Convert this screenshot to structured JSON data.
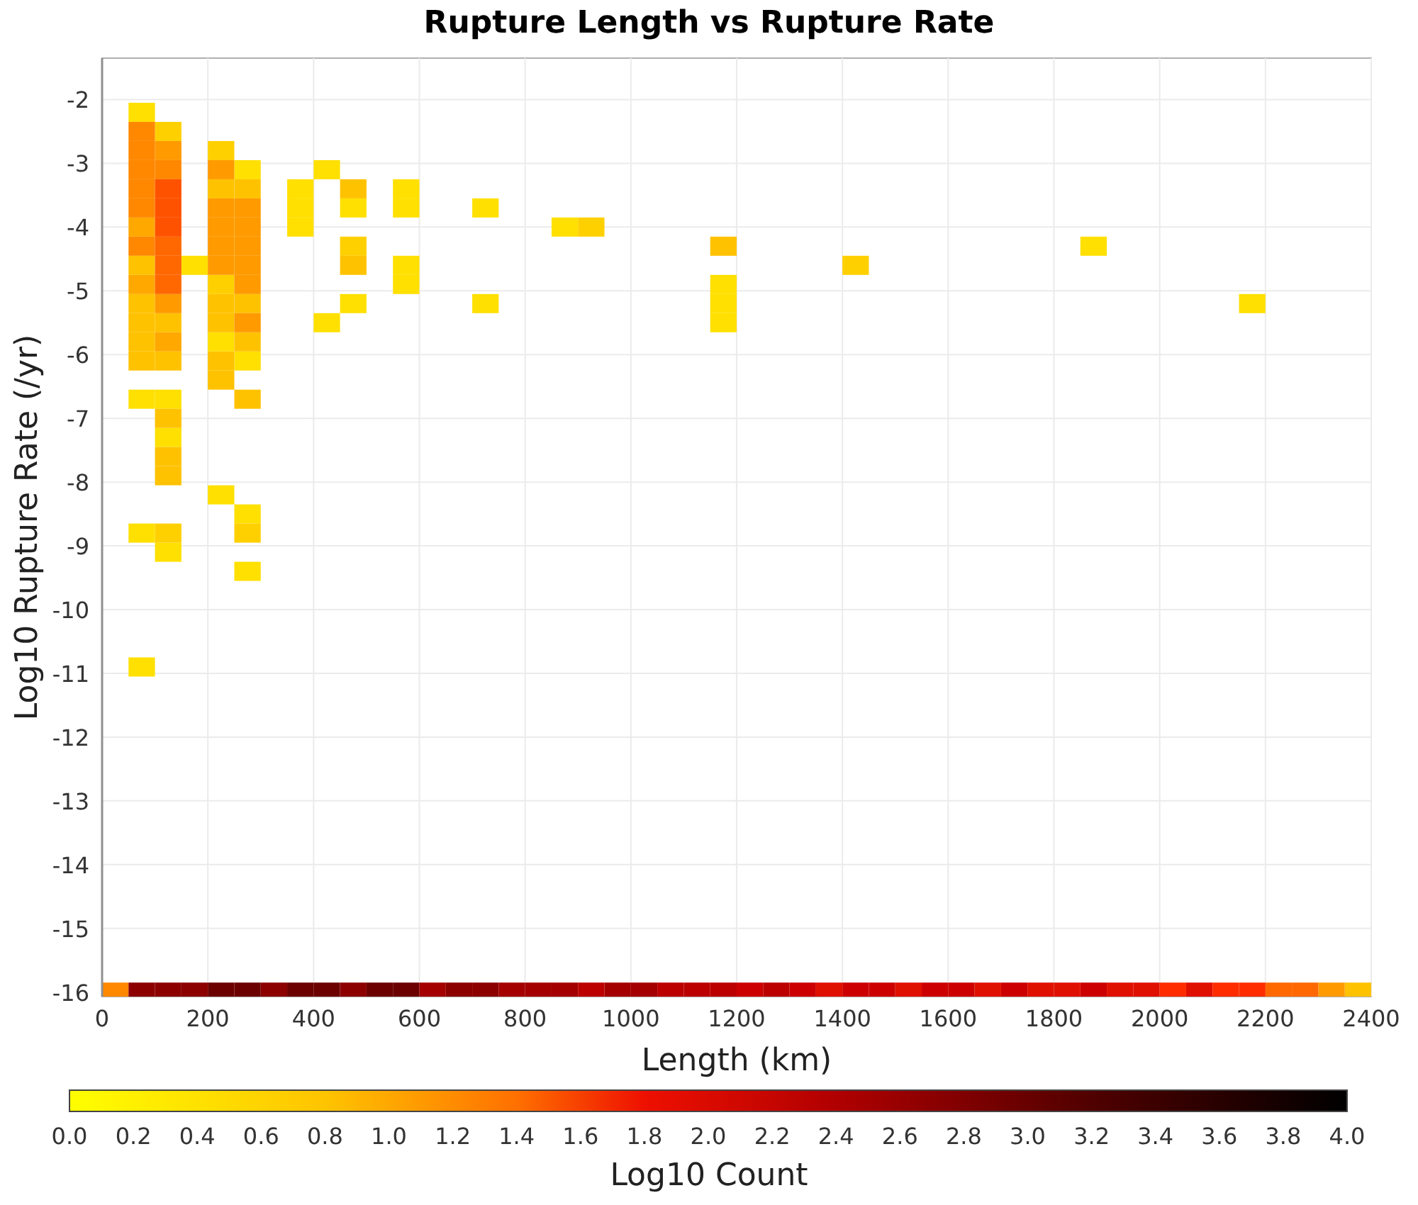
{
  "chart_data": {
    "type": "scatter",
    "title": "Rupture Length vs Rupture Rate",
    "xlabel": "Length (km)",
    "ylabel": "Log10 Rupture Rate (/yr)",
    "xlim": [
      0,
      2400
    ],
    "ylim": [
      -16.07,
      -1.35
    ],
    "xticks": [
      0,
      200,
      400,
      600,
      800,
      1000,
      1200,
      1400,
      1600,
      1800,
      2000,
      2200,
      2400
    ],
    "grid": true,
    "yticks": [
      -16,
      -15,
      -14,
      -13,
      -12,
      -11,
      -10,
      -9,
      -8,
      -7,
      -6,
      -5,
      -4,
      -3,
      -2
    ],
    "series": [
      {
        "color": "#ffe000",
        "x": [
          75,
          75,
          75,
          75,
          125,
          125,
          125,
          175,
          225,
          225,
          275,
          275,
          275,
          275,
          375,
          375,
          375,
          425,
          425,
          475,
          475,
          575,
          575,
          575,
          575,
          725,
          725,
          875,
          1175,
          1175,
          1175,
          1875,
          2175
        ],
        "values": [
          -2.2,
          -6.7,
          -8.8,
          -10.9,
          -6.7,
          -7.3,
          -9.1,
          -4.6,
          -5.8,
          -8.2,
          -3.1,
          -6.1,
          -8.5,
          -9.4,
          -3.4,
          -3.7,
          -4.0,
          -3.1,
          -5.5,
          -3.7,
          -5.2,
          -3.4,
          -3.7,
          -4.6,
          -4.9,
          -3.7,
          -5.2,
          -4.0,
          -4.9,
          -5.2,
          -5.5,
          -4.3,
          -5.2
        ]
      },
      {
        "color": "#ffd000",
        "x": [
          125,
          125,
          225,
          225,
          275,
          475,
          925,
          1425
        ],
        "values": [
          -2.5,
          -8.8,
          -2.8,
          -4.9,
          -8.8,
          -4.3,
          -4.0,
          -4.6
        ]
      },
      {
        "color": "#ffc200",
        "x": [
          75,
          75,
          75,
          75,
          75,
          125,
          125,
          125,
          125,
          125,
          225,
          225,
          225,
          225,
          225,
          275,
          275,
          275,
          275,
          475,
          475,
          1175,
          2375
        ],
        "values": [
          -4.6,
          -5.2,
          -5.5,
          -5.8,
          -6.1,
          -5.5,
          -6.1,
          -7.0,
          -7.6,
          -7.9,
          -3.4,
          -5.2,
          -5.5,
          -6.1,
          -6.4,
          -3.4,
          -5.2,
          -5.8,
          -6.7,
          -3.4,
          -4.6,
          -4.3,
          -16
        ]
      },
      {
        "color": "#ffa800",
        "x": [
          75,
          75,
          125
        ],
        "values": [
          -4.0,
          -4.9,
          -5.8
        ]
      },
      {
        "color": "#ff9a00",
        "x": [
          125,
          125,
          225,
          225,
          225,
          225,
          225,
          275,
          275,
          275,
          275,
          275,
          275,
          2325
        ],
        "values": [
          -2.8,
          -5.2,
          -3.1,
          -3.7,
          -4.0,
          -4.3,
          -4.6,
          -3.7,
          -4.0,
          -4.3,
          -4.6,
          -4.9,
          -5.5,
          -16
        ]
      },
      {
        "color": "#ff8800",
        "x": [
          75,
          75,
          75,
          75,
          75,
          75,
          125,
          25
        ],
        "values": [
          -2.5,
          -2.8,
          -3.1,
          -3.4,
          -3.7,
          -4.3,
          -3.1,
          -16
        ]
      },
      {
        "color": "#ff6800",
        "x": [
          125,
          125,
          125,
          2225,
          2275
        ],
        "values": [
          -4.3,
          -4.6,
          -4.9,
          -16,
          -16
        ]
      },
      {
        "color": "#ff5200",
        "x": [
          125,
          125,
          125
        ],
        "values": [
          -3.4,
          -3.7,
          -4.0
        ]
      },
      {
        "color": "#6c0000",
        "x": [
          225,
          275,
          375,
          425,
          525,
          575
        ],
        "values": [
          -16,
          -16,
          -16,
          -16,
          -16,
          -16
        ]
      },
      {
        "color": "#8c0000",
        "x": [
          75,
          125,
          175,
          325,
          475,
          675,
          725
        ],
        "values": [
          -16,
          -16,
          -16,
          -16,
          -16,
          -16,
          -16
        ]
      },
      {
        "color": "#a40000",
        "x": [
          625,
          775,
          825,
          875,
          975,
          1025
        ],
        "values": [
          -16,
          -16,
          -16,
          -16,
          -16,
          -16
        ]
      },
      {
        "color": "#bc0000",
        "x": [
          925,
          1075,
          1125,
          1175,
          1275
        ],
        "values": [
          -16,
          -16,
          -16,
          -16,
          -16
        ]
      },
      {
        "color": "#cc0000",
        "x": [
          1225,
          1325,
          1425,
          1475,
          1575,
          1625,
          1725,
          1875
        ],
        "values": [
          -16,
          -16,
          -16,
          -16,
          -16,
          -16,
          -16,
          -16
        ]
      },
      {
        "color": "#e01000",
        "x": [
          1375,
          1525,
          1675,
          1775,
          1825,
          1925,
          1975,
          2075
        ],
        "values": [
          -16,
          -16,
          -16,
          -16,
          -16,
          -16,
          -16,
          -16
        ]
      },
      {
        "color": "#ff2c00",
        "x": [
          2025,
          2125,
          2175
        ],
        "values": [
          -16,
          -16,
          -16
        ]
      }
    ]
  },
  "colorbar": {
    "label": "Log10 Count",
    "ticks": [
      "0.0",
      "0.2",
      "0.4",
      "0.6",
      "0.8",
      "1.0",
      "1.2",
      "1.4",
      "1.6",
      "1.8",
      "2.0",
      "2.2",
      "2.4",
      "2.6",
      "2.8",
      "3.0",
      "3.2",
      "3.4",
      "3.6",
      "3.8",
      "4.0"
    ]
  }
}
